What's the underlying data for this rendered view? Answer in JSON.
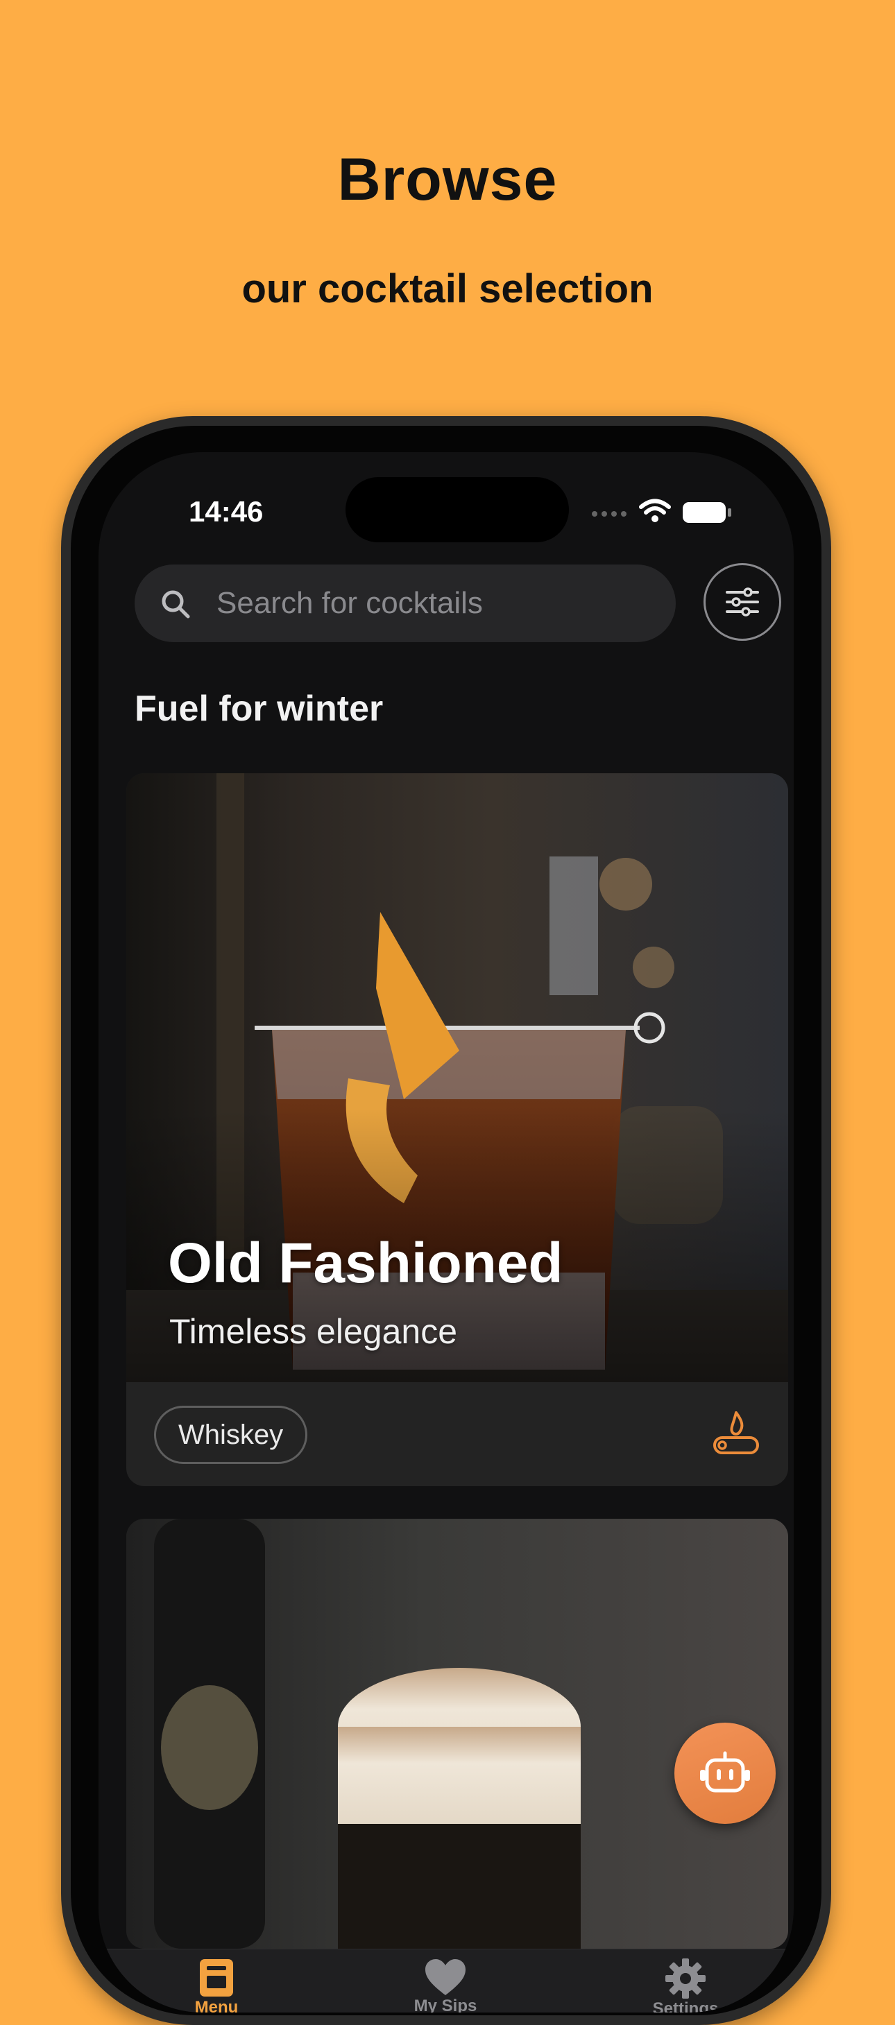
{
  "hero": {
    "title": "Browse",
    "subtitle": "our cocktail selection"
  },
  "status_bar": {
    "time": "14:46"
  },
  "search": {
    "placeholder": "Search for cocktails"
  },
  "section": {
    "title": "Fuel for winter"
  },
  "cards": [
    {
      "title": "Old Fashioned",
      "subtitle": "Timeless elegance",
      "tag": "Whiskey",
      "icon": "fire-log-icon"
    }
  ],
  "tabs": [
    {
      "label": "Menu",
      "icon": "menu-book-icon",
      "active": true
    },
    {
      "label": "My Sips",
      "icon": "heart-icon",
      "active": false
    },
    {
      "label": "Settings",
      "icon": "gear-icon",
      "active": false
    }
  ],
  "colors": {
    "background": "#FEAD45",
    "accent": "#F3A240",
    "bot_button": "#EE8B4E",
    "screen": "#111112"
  }
}
